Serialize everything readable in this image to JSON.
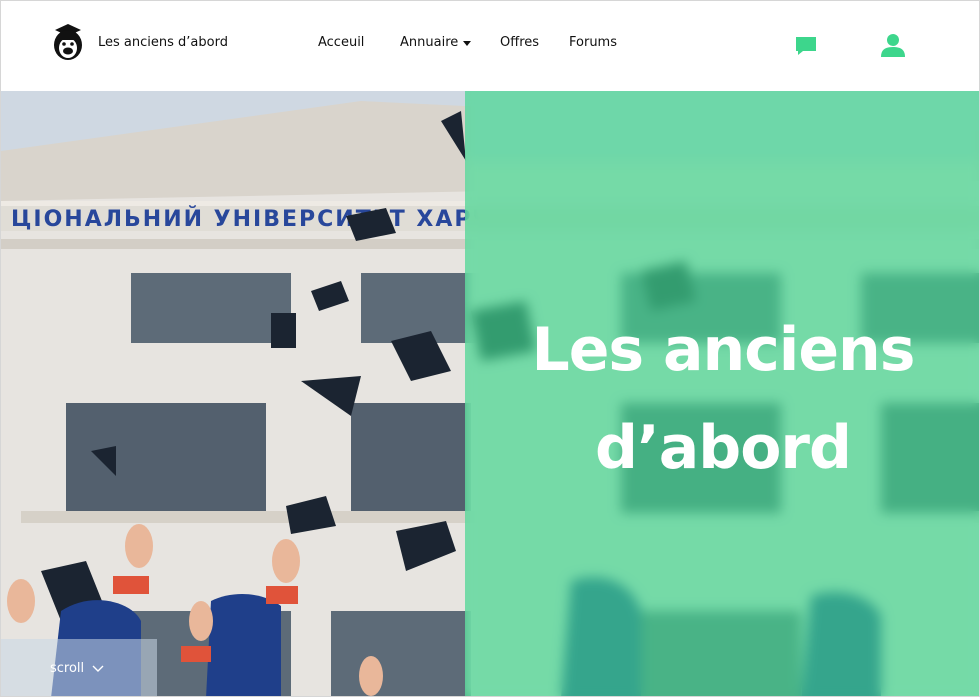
{
  "header": {
    "brand": "Les anciens d’abord",
    "logo_icon": "gorilla-graduate-icon",
    "nav": [
      {
        "label": "Acceuil"
      },
      {
        "label": "Annuaire",
        "icon": "caret-down-icon"
      },
      {
        "label": "Offres"
      },
      {
        "label": "Forums"
      }
    ],
    "messages_icon": "chat-bubble-icon",
    "profile_icon": "user-icon"
  },
  "hero": {
    "title_line1": "Les anciens",
    "title_line2": "d’abord",
    "scroll_label": "scroll",
    "scroll_icon": "chevron-down-icon",
    "background_image": "graduates throwing caps in front of university building"
  },
  "colors": {
    "accent_green": "#3dd68c",
    "overlay_green": "#3fd68d",
    "text_dark": "#111111"
  }
}
